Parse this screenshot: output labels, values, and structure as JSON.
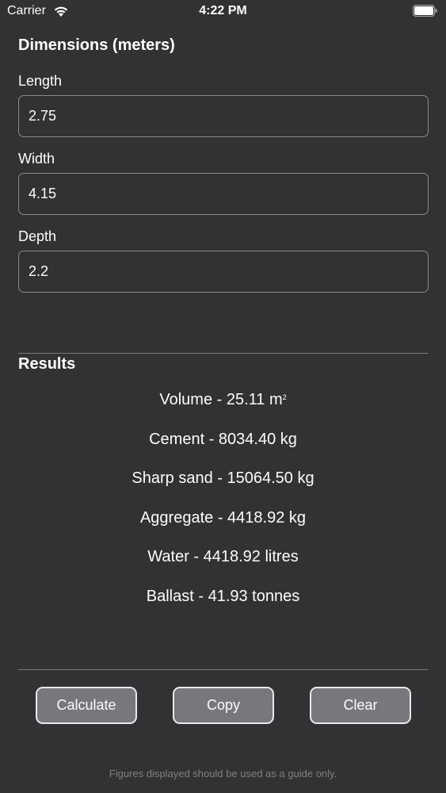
{
  "status_bar": {
    "carrier": "Carrier",
    "time": "4:22 PM",
    "wifi_icon": "wifi-icon",
    "battery_icon": "battery-icon"
  },
  "dimensions": {
    "title": "Dimensions (meters)",
    "length": {
      "label": "Length",
      "value": "2.75"
    },
    "width": {
      "label": "Width",
      "value": "4.15"
    },
    "depth": {
      "label": "Depth",
      "value": "2.2"
    }
  },
  "results": {
    "title": "Results",
    "volume": {
      "text": "Volume - 25.11 m",
      "unit_superscript": "2"
    },
    "cement": "Cement - 8034.40 kg",
    "sharp_sand": "Sharp sand - 15064.50 kg",
    "aggregate": "Aggregate - 4418.92 kg",
    "water": "Water - 4418.92 litres",
    "ballast": "Ballast - 41.93 tonnes"
  },
  "actions": {
    "calculate": "Calculate",
    "copy": "Copy",
    "clear": "Clear"
  },
  "disclaimer": "Figures displayed should be used as a guide only.",
  "colors": {
    "background": "#323133",
    "button_fill": "#78777b",
    "button_border": "#e9e9e9",
    "input_border": "#8a898c",
    "disclaimer_text": "#807f83"
  }
}
